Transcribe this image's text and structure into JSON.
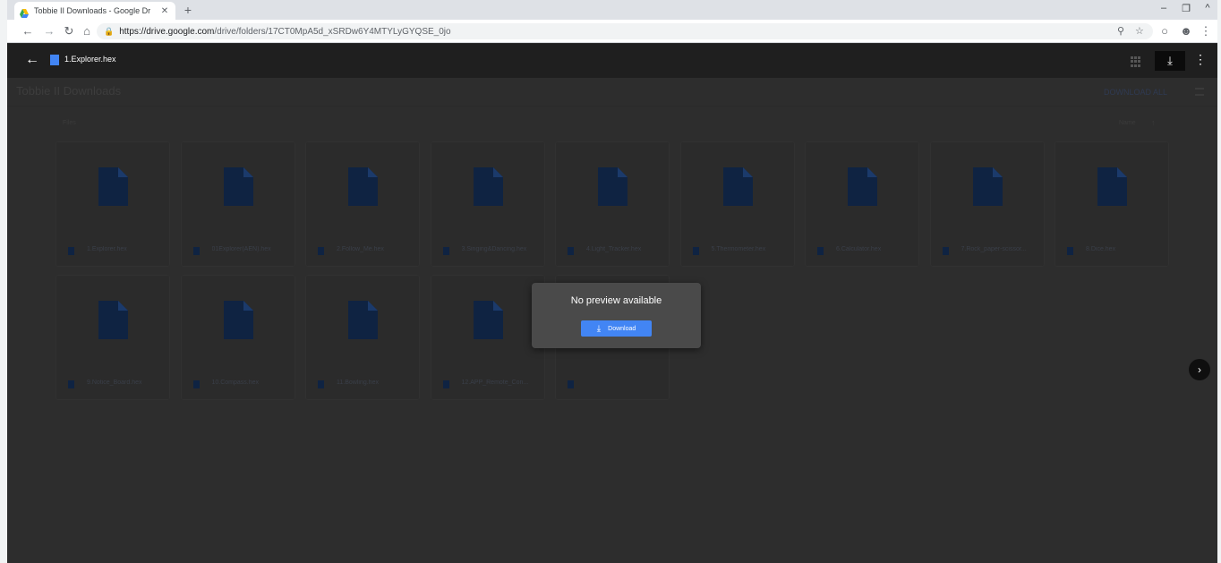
{
  "browser": {
    "tab_title": "Tobbie II Downloads - Google Dr",
    "new_tab_icon": "plus-icon",
    "url_host": "https://drive.google.com",
    "url_path": "/drive/folders/17CT0MpA5d_xSRDw6Y4MTYLyGYQSE_0jo"
  },
  "viewer": {
    "file_name": "1.Explorer.hex",
    "folder_title": "Tobbie II Downloads",
    "download_all": "DOWNLOAD ALL",
    "files_label": "Files",
    "sort_label": "Name",
    "files": [
      {
        "name": "1.Explorer.hex"
      },
      {
        "name": "01Explorer(AEN).hex"
      },
      {
        "name": "2.Follow_Me.hex"
      },
      {
        "name": "3.Singing&Dancing.hex"
      },
      {
        "name": "4.Light_Tracker.hex"
      },
      {
        "name": "5.Thermometer.hex"
      },
      {
        "name": "6.Calculator.hex"
      },
      {
        "name": "7.Rock_paper-scissor..."
      },
      {
        "name": "8.Dice.hex"
      },
      {
        "name": "9.Notice_Board.hex"
      },
      {
        "name": "10.Compass.hex"
      },
      {
        "name": "11.Bowling.hex"
      },
      {
        "name": "12.APP_Remote_Con..."
      },
      {
        "name": ""
      }
    ]
  },
  "dialog": {
    "title": "No preview available",
    "button_label": "Download"
  },
  "colors": {
    "accent": "#4285f4",
    "dimmed_file_icon": "#0f2342"
  }
}
